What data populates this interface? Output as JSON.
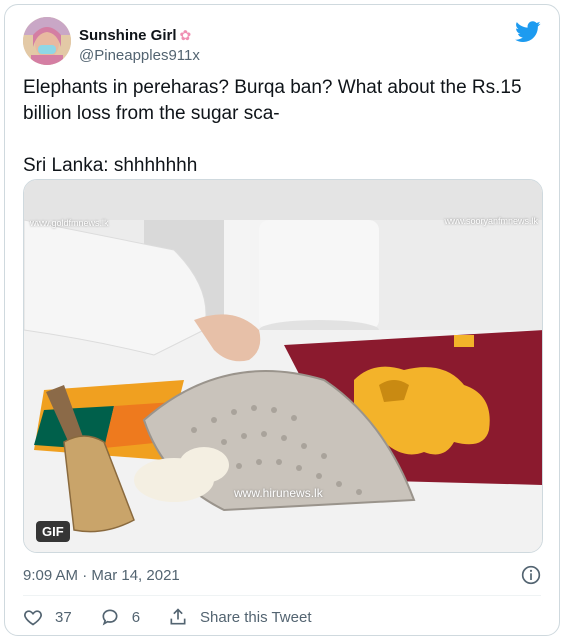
{
  "tweet": {
    "display_name": "Sunshine Girl",
    "name_emoji": "cherry-blossom-icon",
    "handle": "@Pineapples911x",
    "text_line1": "Elephants in pereharas? Burqa ban? What about the Rs.15 billion loss from the sugar sca-",
    "text_line2": "Sri Lanka: shhhhhhh",
    "media": {
      "gif_label": "GIF",
      "watermark_left": "www.goldfmnews.lk",
      "watermark_right": "www.sooryanfmnews.lk",
      "watermark_bottom": "www.hirunews.lk",
      "flag_colors": {
        "maroon": "#8b1a2e",
        "gold": "#f3b32a",
        "green": "#00604b",
        "orange": "#ee7a1e"
      }
    },
    "timestamp": "9:09 AM · Mar 14, 2021",
    "actions": {
      "like_count": "37",
      "reply_count": "6",
      "share_label": "Share this Tweet"
    },
    "accent_color": "#1d9bf0"
  }
}
